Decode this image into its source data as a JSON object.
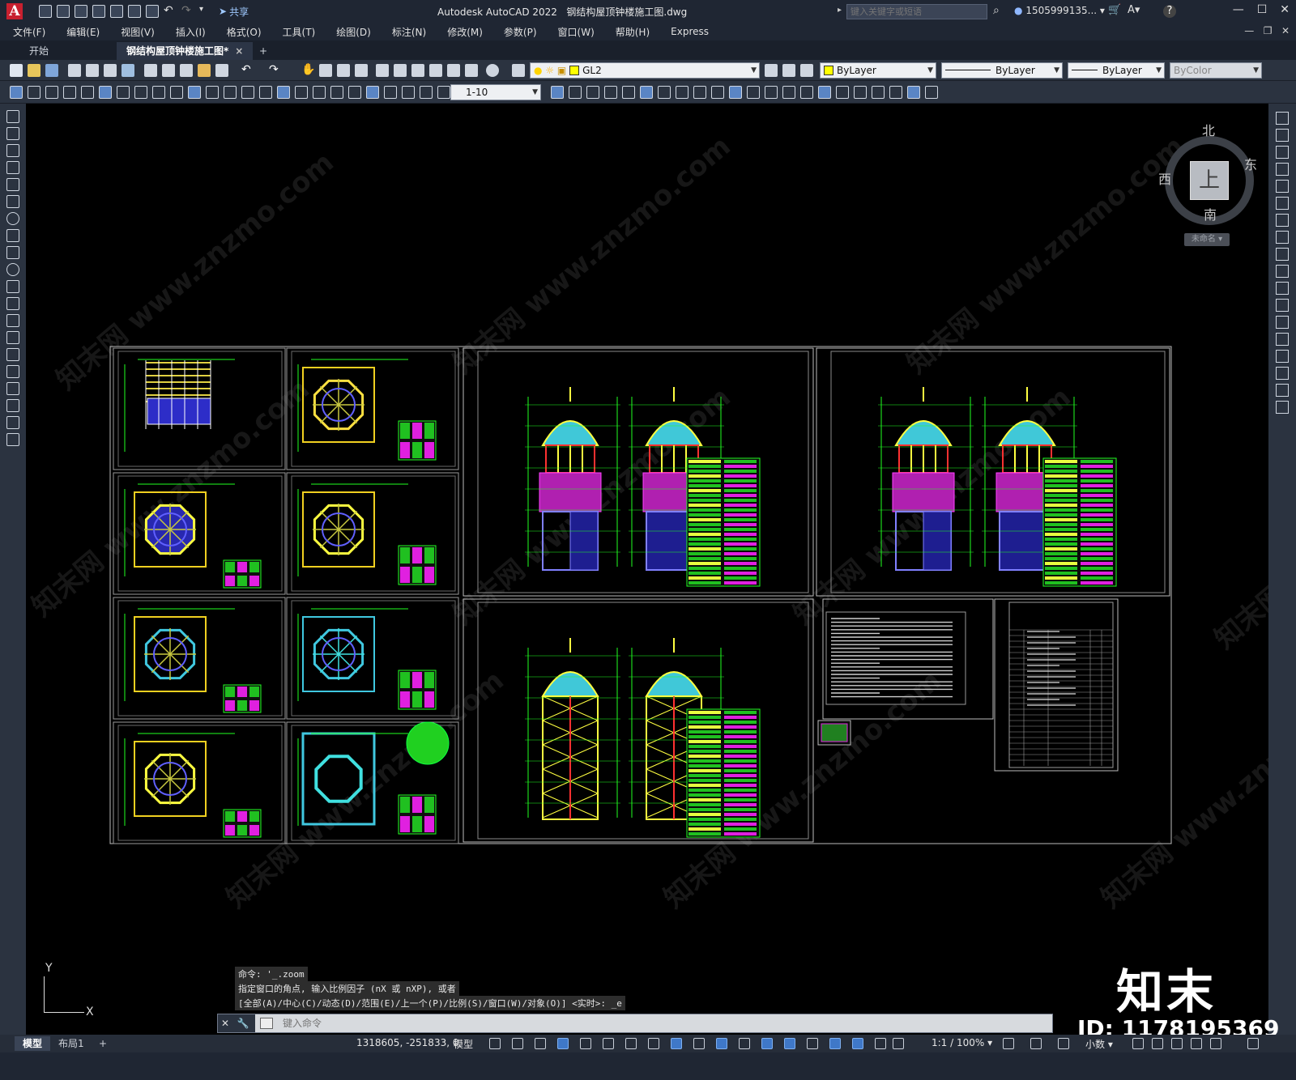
{
  "titlebar": {
    "logo": "A",
    "share_label": "共享",
    "app_title": "Autodesk AutoCAD 2022",
    "doc_title": "钢结构屋顶钟楼施工图.dwg",
    "search_placeholder": "键入关键字或短语",
    "user": "1505999135...",
    "help": "?"
  },
  "menubar": {
    "items": [
      "文件(F)",
      "编辑(E)",
      "视图(V)",
      "插入(I)",
      "格式(O)",
      "工具(T)",
      "绘图(D)",
      "标注(N)",
      "修改(M)",
      "参数(P)",
      "窗口(W)",
      "帮助(H)",
      "Express"
    ]
  },
  "tabs": {
    "start": "开始",
    "active": "钢结构屋顶钟楼施工图*",
    "close": "×",
    "add": "+"
  },
  "toolbar1": {
    "layer": "GL2",
    "color": "ByLayer",
    "linetype": "ByLayer",
    "lineweight": "ByLayer",
    "plotstyle": "ByColor"
  },
  "toolbar2": {
    "scale": "1-10"
  },
  "viewcube": {
    "north": "北",
    "south": "南",
    "east": "东",
    "west": "西",
    "face": "上",
    "ucs_menu": "未命名"
  },
  "watermark": "知末网 www.znzmo.com",
  "command": {
    "history": [
      "命令: '_.zoom",
      "指定窗口的角点, 输入比例因子 (nX 或 nXP), 或者",
      "[全部(A)/中心(C)/动态(D)/范围(E)/上一个(P)/比例(S)/窗口(W)/对象(O)] <实时>: _e"
    ],
    "placeholder": "键入命令"
  },
  "ucs": {
    "y": "Y",
    "x": "X"
  },
  "brand": {
    "name": "知末",
    "id": "ID: 1178195369"
  },
  "statusbar": {
    "model_tab": "模型",
    "layout_tab": "布局1",
    "add": "+",
    "coords": "1318605, -251833, 0",
    "space": "模型",
    "annoscale": "1:1 / 100%",
    "units": "小数"
  }
}
